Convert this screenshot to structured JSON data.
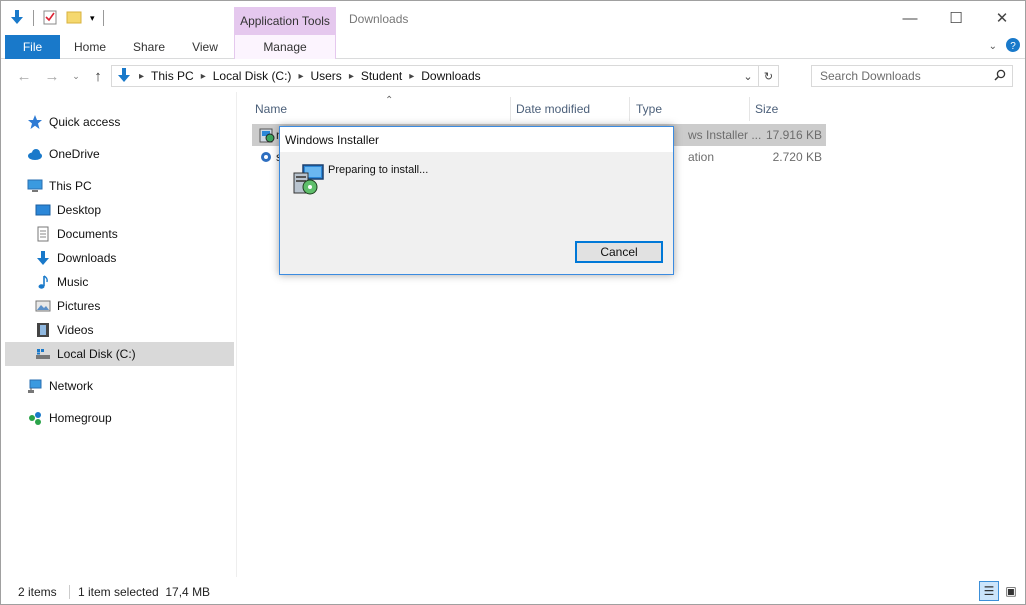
{
  "window": {
    "title": "Downloads",
    "context_tab_group": "Application Tools"
  },
  "ribbon": {
    "tabs": [
      "File",
      "Home",
      "Share",
      "View",
      "Manage"
    ]
  },
  "address": {
    "crumbs": [
      "This PC",
      "Local Disk (C:)",
      "Users",
      "Student",
      "Downloads"
    ]
  },
  "search": {
    "placeholder": "Search Downloads"
  },
  "nav": {
    "items": [
      {
        "label": "Quick access",
        "icon": "star-icon"
      },
      {
        "label": "OneDrive",
        "icon": "cloud-icon"
      },
      {
        "label": "This PC",
        "icon": "computer-icon"
      },
      {
        "label": "Desktop",
        "icon": "desktop-icon"
      },
      {
        "label": "Documents",
        "icon": "documents-icon"
      },
      {
        "label": "Downloads",
        "icon": "download-arrow-icon"
      },
      {
        "label": "Music",
        "icon": "music-note-icon"
      },
      {
        "label": "Pictures",
        "icon": "pictures-icon"
      },
      {
        "label": "Videos",
        "icon": "film-icon"
      },
      {
        "label": "Local Disk (C:)",
        "icon": "disk-drive-icon"
      },
      {
        "label": "Network",
        "icon": "network-icon"
      },
      {
        "label": "Homegroup",
        "icon": "homegroup-icon"
      }
    ]
  },
  "columns": {
    "name": "Name",
    "date": "Date modified",
    "type": "Type",
    "size": "Size"
  },
  "files": [
    {
      "name_fragment": "n",
      "type": "ws Installer ...",
      "size": "17.916 KB"
    },
    {
      "name_fragment": "s",
      "type": "ation",
      "size": "2.720 KB"
    }
  ],
  "status": {
    "count": "2 items",
    "selection": "1 item selected  17,4 MB"
  },
  "dialog": {
    "title": "Windows Installer",
    "message": "Preparing to install...",
    "cancel_label": "Cancel"
  },
  "colors": {
    "file_tab": "#1979ca",
    "context_tab": "#e5c8ee",
    "selection": "#d9d9d9",
    "dialog_border": "#3b8be0"
  }
}
